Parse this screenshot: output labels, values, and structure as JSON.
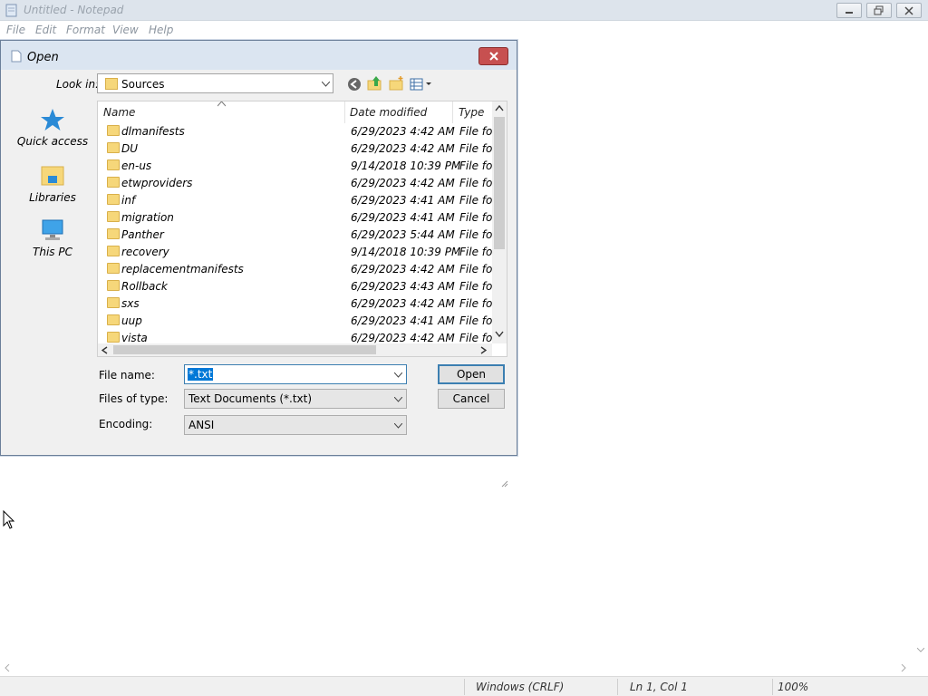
{
  "window": {
    "title": "Untitled - Notepad"
  },
  "menu": {
    "items": [
      "File",
      "Edit",
      "Format",
      "View",
      "Help"
    ]
  },
  "status": {
    "line_ending": "Windows (CRLF)",
    "position": "Ln 1, Col 1",
    "zoom": "100%"
  },
  "dialog": {
    "title": "Open",
    "look_in_label": "Look in:",
    "look_in_value": "Sources",
    "places": [
      "Quick access",
      "Libraries",
      "This PC"
    ],
    "columns": {
      "name": "Name",
      "date": "Date modified",
      "type": "Type"
    },
    "rows": [
      {
        "name": "dlmanifests",
        "date": "6/29/2023 4:42 AM",
        "type": "File folder"
      },
      {
        "name": "DU",
        "date": "6/29/2023 4:42 AM",
        "type": "File folder"
      },
      {
        "name": "en-us",
        "date": "9/14/2018 10:39 PM",
        "type": "File folder"
      },
      {
        "name": "etwproviders",
        "date": "6/29/2023 4:42 AM",
        "type": "File folder"
      },
      {
        "name": "inf",
        "date": "6/29/2023 4:41 AM",
        "type": "File folder"
      },
      {
        "name": "migration",
        "date": "6/29/2023 4:41 AM",
        "type": "File folder"
      },
      {
        "name": "Panther",
        "date": "6/29/2023 5:44 AM",
        "type": "File folder"
      },
      {
        "name": "recovery",
        "date": "9/14/2018 10:39 PM",
        "type": "File folder"
      },
      {
        "name": "replacementmanifests",
        "date": "6/29/2023 4:42 AM",
        "type": "File folder"
      },
      {
        "name": "Rollback",
        "date": "6/29/2023 4:43 AM",
        "type": "File folder"
      },
      {
        "name": "sxs",
        "date": "6/29/2023 4:42 AM",
        "type": "File folder"
      },
      {
        "name": "uup",
        "date": "6/29/2023 4:41 AM",
        "type": "File folder"
      },
      {
        "name": "vista",
        "date": "6/29/2023 4:42 AM",
        "type": "File folder"
      }
    ],
    "file_name_label": "File name:",
    "file_name_value": "*.txt",
    "files_of_type_label": "Files of type:",
    "files_of_type_value": "Text Documents (*.txt)",
    "encoding_label": "Encoding:",
    "encoding_value": "ANSI",
    "open_label": "Open",
    "cancel_label": "Cancel"
  },
  "colors": {
    "accent": "#3c7fb1",
    "folder": "#f6d77a",
    "close": "#c75050"
  }
}
